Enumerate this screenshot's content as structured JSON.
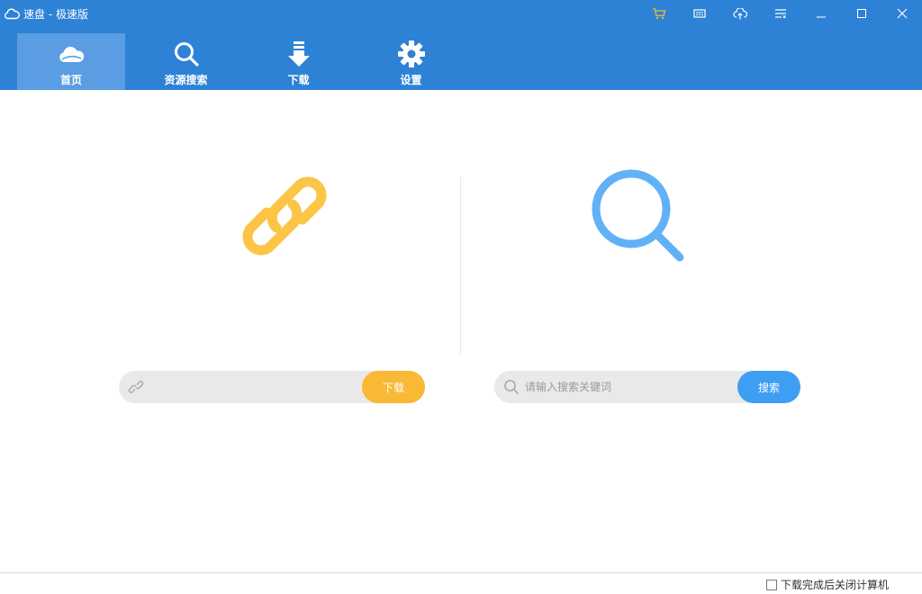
{
  "window": {
    "title": "速盘 - 极速版",
    "controls": [
      "cart-icon",
      "tray-icon",
      "upload-cloud-icon",
      "menu-icon",
      "minimize-icon",
      "maximize-icon",
      "close-icon"
    ]
  },
  "nav": {
    "tabs": [
      {
        "label": "首页",
        "icon": "cloud-icon",
        "active": true
      },
      {
        "label": "资源搜索",
        "icon": "search-icon",
        "active": false
      },
      {
        "label": "下载",
        "icon": "download-arrow-icon",
        "active": false
      },
      {
        "label": "设置",
        "icon": "gear-icon",
        "active": false
      }
    ]
  },
  "link_download": {
    "icon": "paperclip-link-icon",
    "input_value": "",
    "button_label": "下载"
  },
  "search": {
    "icon": "magnifier-icon",
    "placeholder": "请输入搜索关键词",
    "button_label": "搜索"
  },
  "footer": {
    "checkbox_label": "下载完成后关闭计算机",
    "checked": false
  },
  "colors": {
    "header": "#2d82d6",
    "active_tab": "#5a9de2",
    "link_accent": "#fcc547",
    "download_button": "#f9b935",
    "search_accent": "#61b1f7",
    "search_button": "#3e9ef3"
  }
}
